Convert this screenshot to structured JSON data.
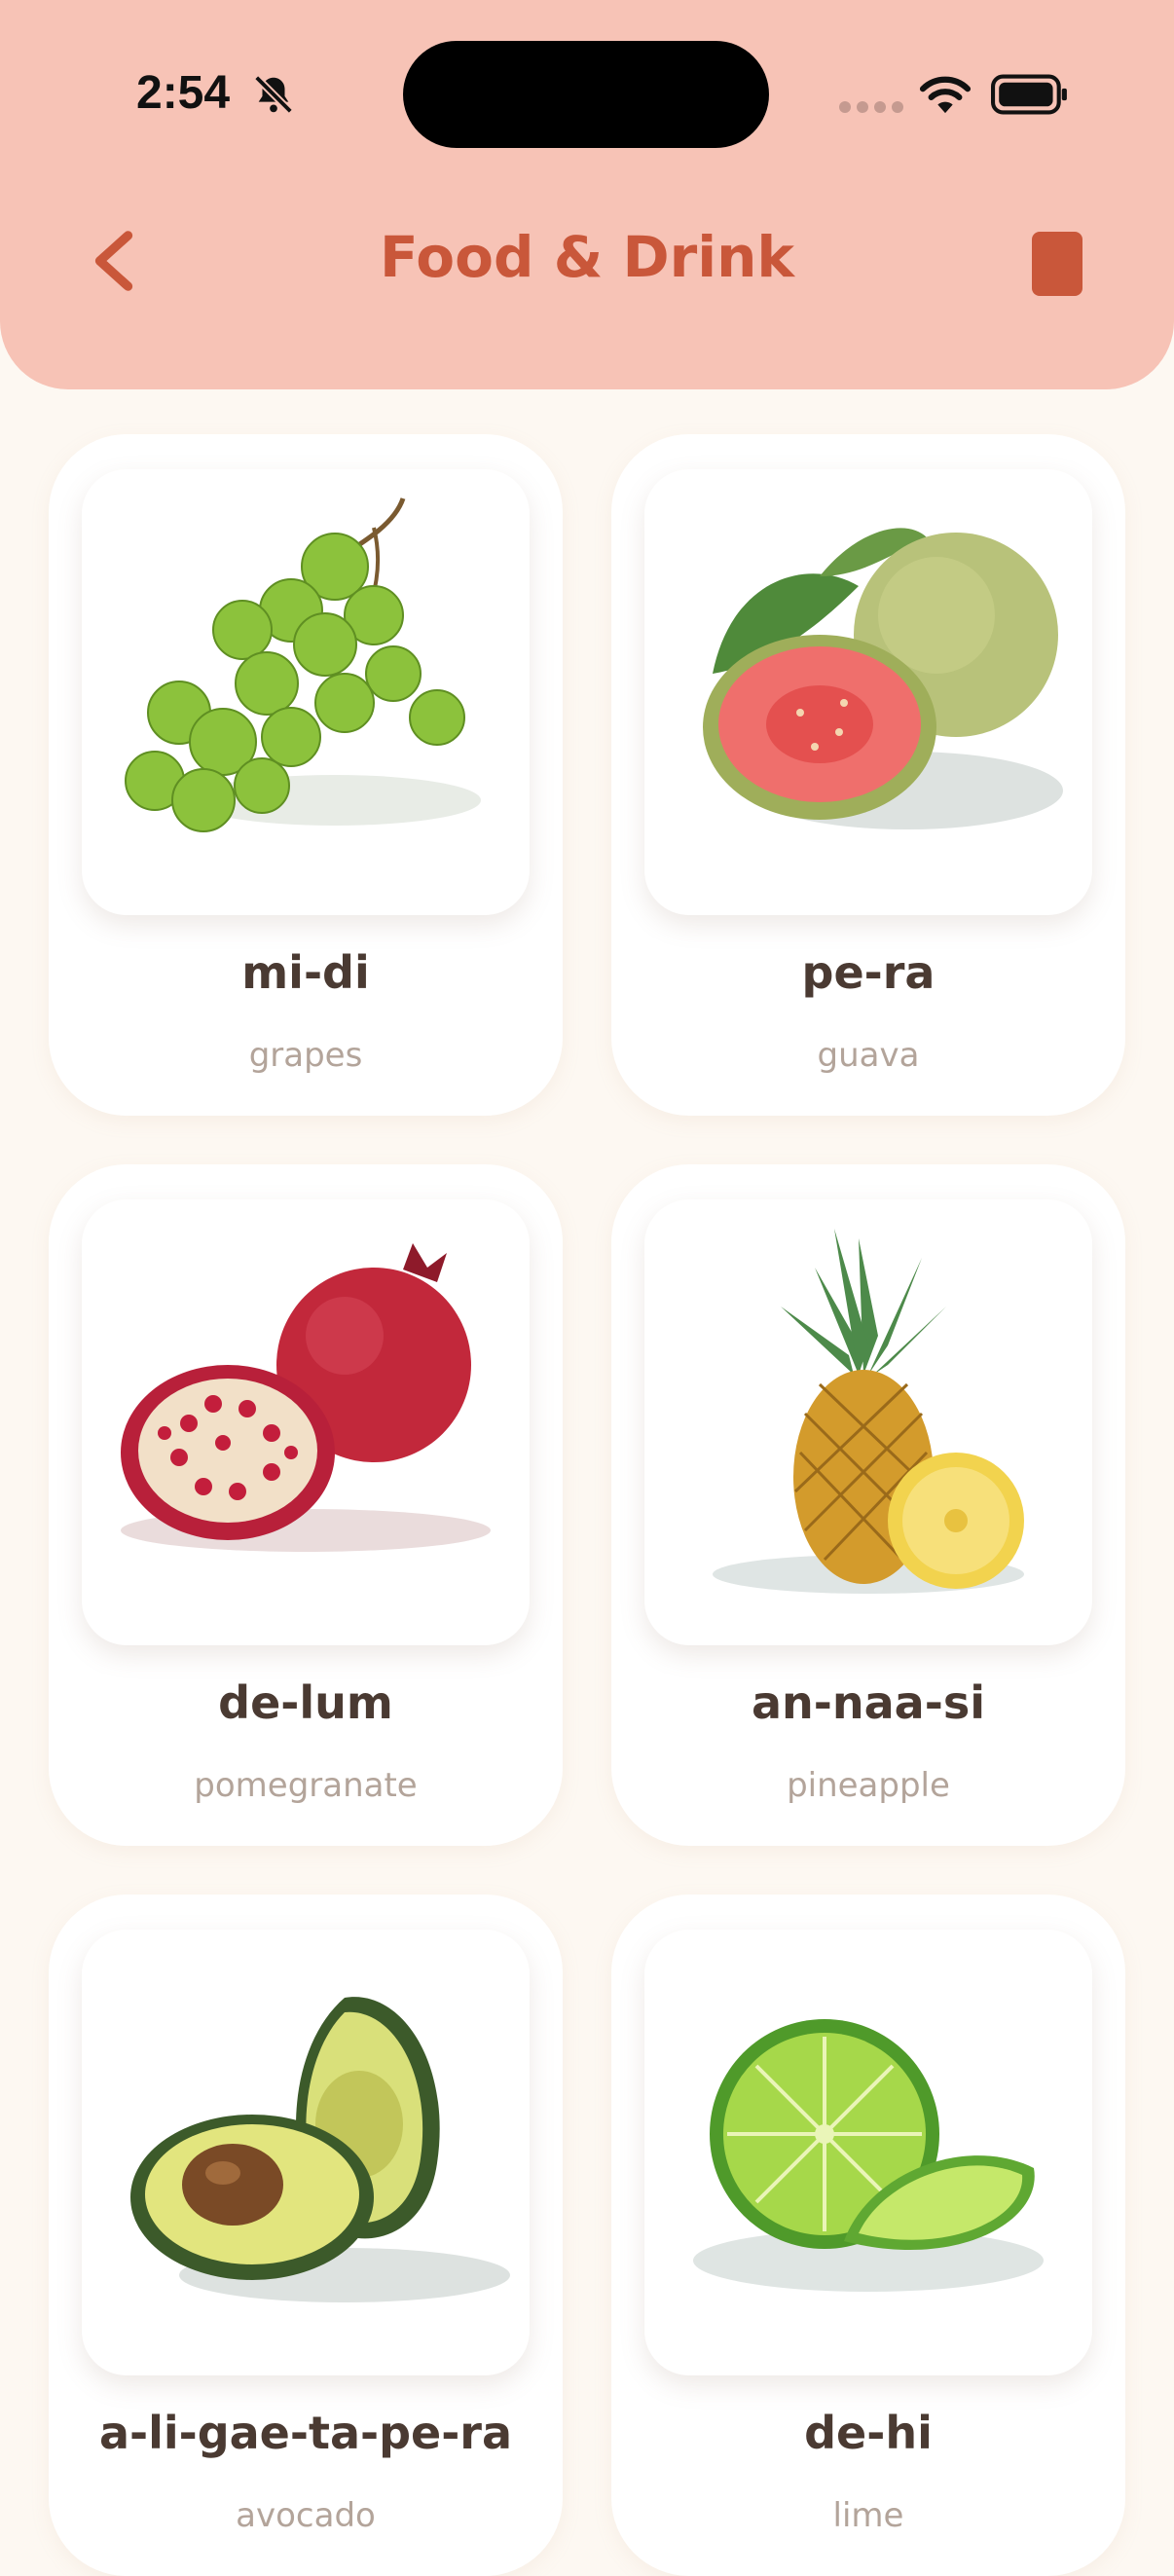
{
  "status_bar": {
    "time": "2:54"
  },
  "header": {
    "title": "Food & Drink"
  },
  "icons": {
    "back": "chevron-left-icon",
    "stop": "stop-icon",
    "bell": "bell-slash-icon",
    "wifi": "wifi-icon",
    "battery": "battery-icon"
  },
  "colors": {
    "header_bg": "#f7c3b6",
    "accent": "#c9573a",
    "page_bg": "#fdf8f2"
  },
  "cards": [
    {
      "word": "mi-di",
      "translation": "grapes",
      "image": "grapes"
    },
    {
      "word": "pe-ra",
      "translation": "guava",
      "image": "guava"
    },
    {
      "word": "de-lum",
      "translation": "pomegranate",
      "image": "pomegranate"
    },
    {
      "word": "an-naa-si",
      "translation": "pineapple",
      "image": "pineapple"
    },
    {
      "word": "a-li-gae-ta-pe-ra",
      "translation": "avocado",
      "image": "avocado"
    },
    {
      "word": "de-hi",
      "translation": "lime",
      "image": "lime"
    }
  ]
}
